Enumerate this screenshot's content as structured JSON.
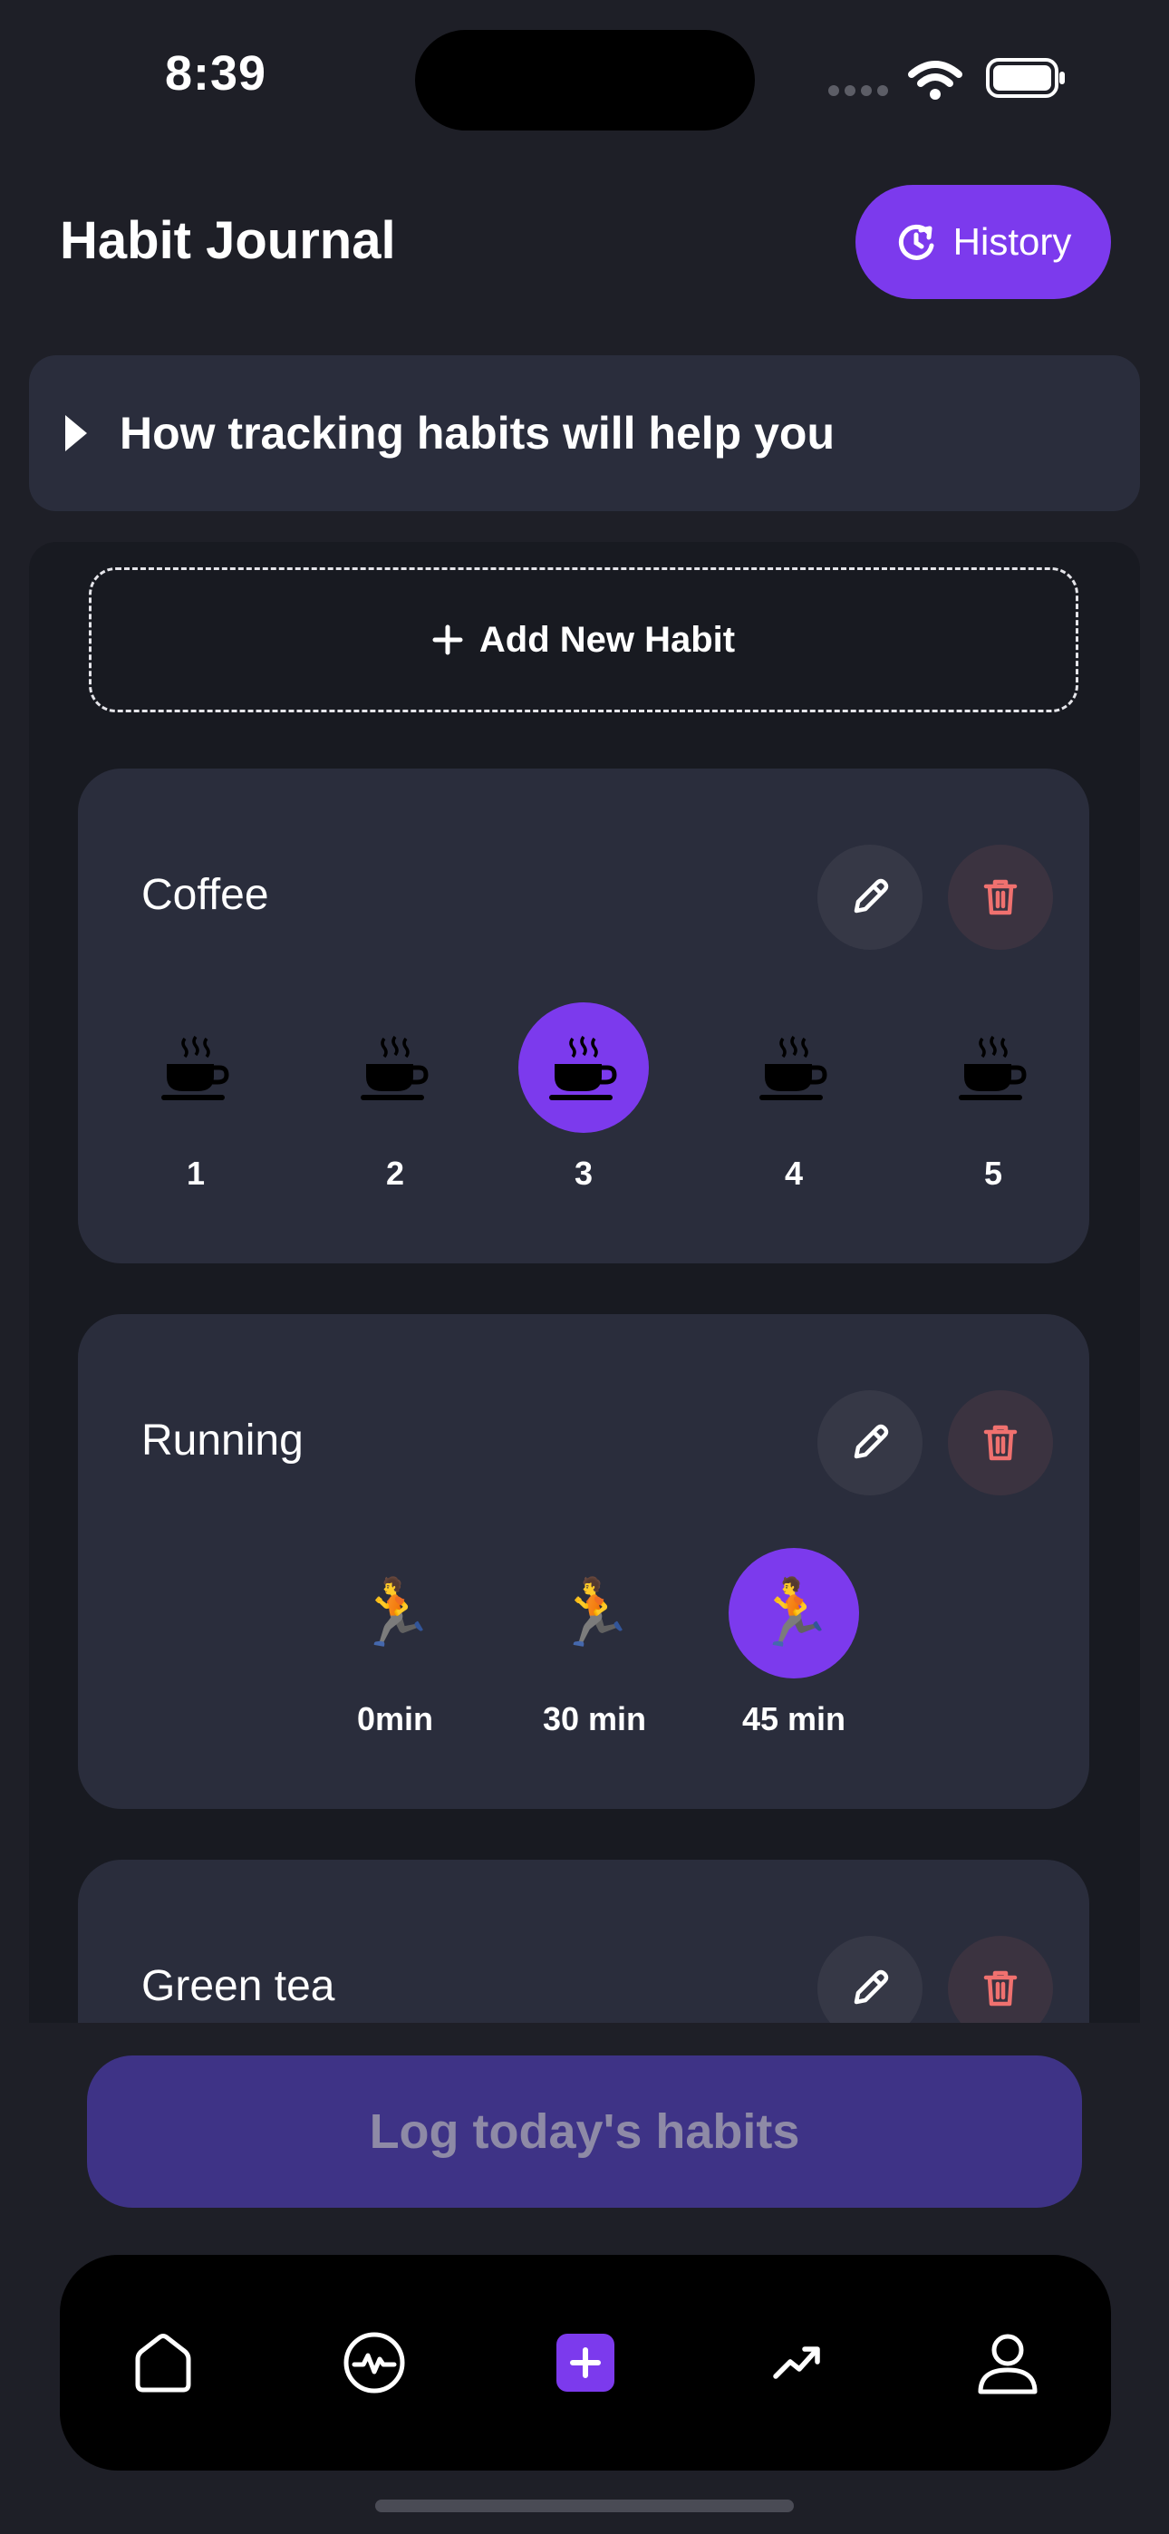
{
  "status_bar": {
    "time": "8:39"
  },
  "header": {
    "title": "Habit Journal",
    "history_label": "History"
  },
  "info_card": {
    "label": "How tracking habits will help you"
  },
  "add_habit": {
    "label": "Add New Habit"
  },
  "habits": [
    {
      "name": "Coffee",
      "icon": "coffee-cup-icon",
      "options": [
        "1",
        "2",
        "3",
        "4",
        "5"
      ],
      "selected": "3"
    },
    {
      "name": "Running",
      "icon": "runner-icon",
      "options": [
        "0min",
        "30 min",
        "45 min"
      ],
      "selected": "45 min"
    },
    {
      "name": "Green tea"
    }
  ],
  "log_button": {
    "label": "Log today's habits"
  },
  "bottom_nav": [
    "home-icon",
    "activity-icon",
    "add-icon",
    "trending-icon",
    "profile-icon"
  ],
  "colors": {
    "accent": "#7c3aed",
    "background": "#1e1f27",
    "card": "#2a2d3c",
    "danger": "#f0716f"
  }
}
